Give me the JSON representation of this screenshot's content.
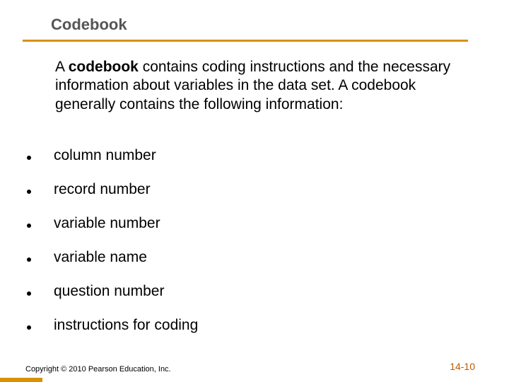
{
  "title": "Codebook",
  "intro": {
    "prefix": "A ",
    "lead": "codebook",
    "rest": " contains coding instructions and the necessary information about variables in the data set.  A codebook generally contains the following information:"
  },
  "bullets": [
    "column number",
    "record number",
    "variable number",
    "variable name",
    "question number",
    "instructions for coding"
  ],
  "footer": {
    "copyright": "Copyright © 2010 Pearson Education, Inc.",
    "pageNumber": "14-10"
  },
  "colors": {
    "accent": "#d99100",
    "titleGray": "#555555",
    "footerRight": "#c05a00"
  }
}
